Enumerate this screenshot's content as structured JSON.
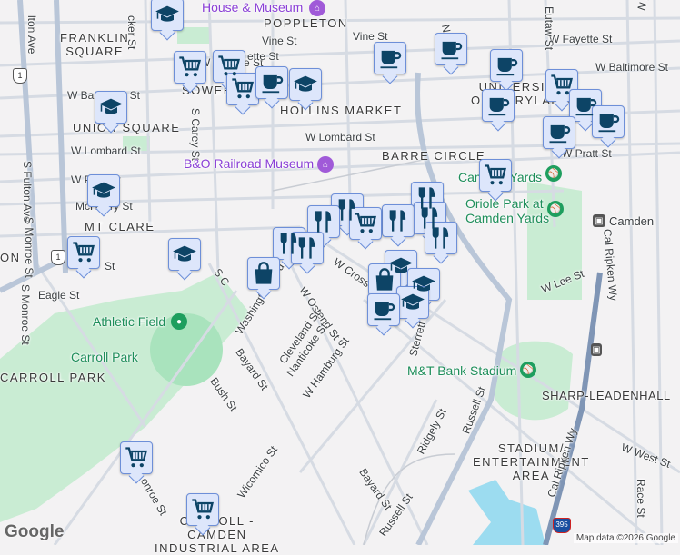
{
  "neighborhoods": {
    "franklin_square": "FRANKLIN\nSQUARE",
    "poppleton": "POPPLETON",
    "union_square": "UNION SQUARE",
    "sowebo": "SOWEBO",
    "hollins_market": "HOLLINS MARKET",
    "university": "UNIVERSITY\nOF MARYLAND",
    "barre_circle": "BARRE CIRCLE",
    "mt_clare": "MT CLARE",
    "carroll_park": "CARROLL PARK",
    "sharp_leadenhall": "SHARP-LEADENHALL",
    "stadium_area": "STADIUM/\nENTERTAINMENT\nAREA",
    "carroll_camden": "CARROLL -\nCAMDEN\nINDUSTRIAL AREA",
    "washington_village": "ON"
  },
  "streets": {
    "fulton": "S Fulton Ave",
    "fulton_n": "lton Ave",
    "monroe": "S Monroe St",
    "monroe2": "S Monroe St",
    "monroe3": "onroe St",
    "fayette_w": "W Fayette St",
    "fayette_mid": "ette St",
    "fayette_e": "W Fayette St",
    "baltimore_w": "W Baltimore St",
    "baltimore_e": "W Baltimore St",
    "vine1": "Vine St",
    "vine2": "Vine St",
    "lombard_w": "W Lombard St",
    "lombard_e": "W Lombard St",
    "pratt_w": "W Pratt St",
    "pratt_e": "W Pratt St",
    "carey": "S Carey St",
    "stricker": "cker St",
    "pine": "N Pine St",
    "mchenry": "McHenry St",
    "eagle": "Eagle St",
    "st_small": "St",
    "washington": "Washington Blvd",
    "ostend": "W Ostend St",
    "cleveland": "Cleveland St",
    "nanticoke": "Nanticoke St",
    "hamburg": "W Hamburg St",
    "bayard1": "Bayard St",
    "bayard2": "Bayard St",
    "bush": "Bush St",
    "cross": "W Cross St",
    "sterrett": "Sterrett St",
    "russell1": "Russell St",
    "russell2": "Russell St",
    "ridgely": "Ridgely St",
    "wicomico": "Wicomico St",
    "lee": "W Lee St",
    "ripken1": "Cal Ripken Wy",
    "ripken2": "Cal Ripken Wy",
    "west": "W West St",
    "race": "Race St",
    "eutaw": "Eutaw St",
    "liberty": "N Liberty St",
    "carey_s": "S C"
  },
  "pois": {
    "house_museum": "House & Museum",
    "bo_museum": "B&O Railroad Museum",
    "camden_yards": "Camden Yards",
    "oriole_park": "Oriole Park at\nCamden Yards",
    "camden_station": "Camden",
    "athletic_field": "Athletic Field",
    "carroll_park_green": "Carroll Park",
    "mt_bank": "M&T Bank Stadium"
  },
  "shields": {
    "us1a": "1",
    "us1b": "1",
    "us1c": "1",
    "i395": "395"
  },
  "markers": [
    "school",
    "cart",
    "cart",
    "cart",
    "coffee",
    "school",
    "school",
    "school",
    "cart",
    "school",
    "coffee",
    "coffee",
    "coffee",
    "cart",
    "coffee",
    "coffee",
    "coffee",
    "coffee",
    "cart",
    "restaurant",
    "restaurant",
    "restaurant",
    "restaurant",
    "restaurant",
    "restaurant",
    "restaurant",
    "cart",
    "restaurant",
    "bag",
    "school",
    "bag",
    "school",
    "school",
    "coffee",
    "cart",
    "cart"
  ],
  "attribution": "Map data ©2026 Google",
  "logo": "Google",
  "colors": {
    "marker_bg": "#dde6fb",
    "marker_border": "#6d8fd8",
    "icon": "#0d4466",
    "park": "#c8ecd4",
    "water": "#9cdcf0"
  }
}
